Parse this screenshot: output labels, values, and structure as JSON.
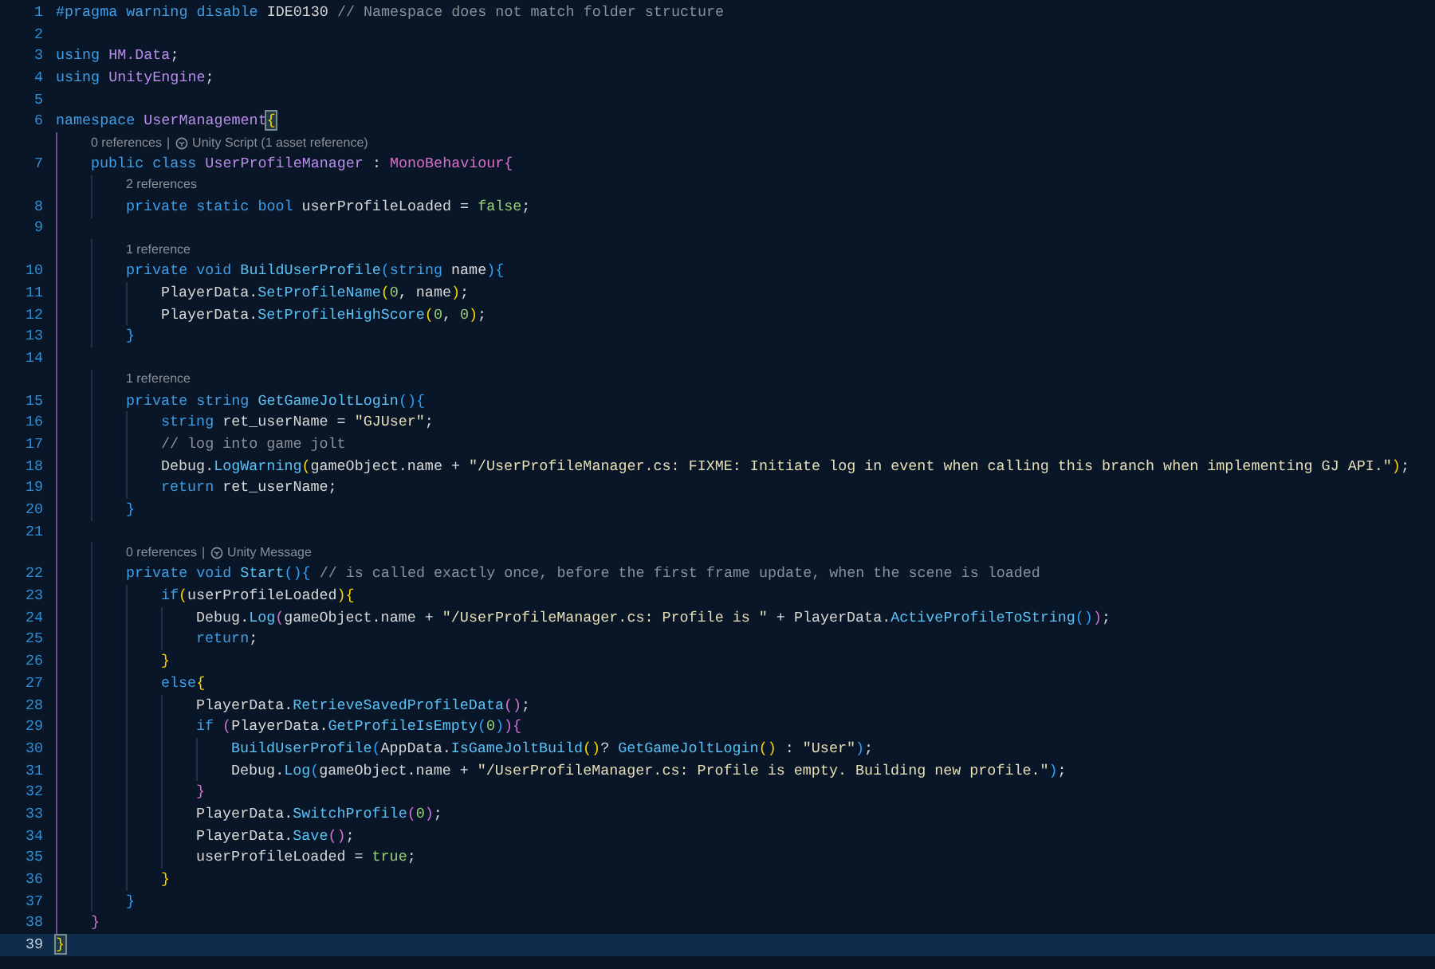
{
  "editor": {
    "lines": [
      {
        "number": "1",
        "tokens": [
          {
            "text": "#pragma warning disable",
            "kind": "k"
          },
          {
            "text": " IDE0130 ",
            "kind": "p"
          },
          {
            "text": "// Namespace does not match folder structure",
            "kind": "cm"
          }
        ]
      },
      {
        "number": "2"
      },
      {
        "number": "3",
        "tokens": [
          {
            "text": "using",
            "kind": "k"
          },
          {
            "text": " HM.Data",
            "kind": "t"
          },
          {
            "text": ";",
            "kind": "p"
          }
        ]
      },
      {
        "number": "4",
        "tokens": [
          {
            "text": "using",
            "kind": "k"
          },
          {
            "text": " UnityEngine",
            "kind": "t"
          },
          {
            "text": ";",
            "kind": "p"
          }
        ]
      },
      {
        "number": "5"
      },
      {
        "number": "6",
        "tokens": [
          {
            "text": "namespace",
            "kind": "k"
          },
          {
            "text": " UserManagement",
            "kind": "t"
          },
          {
            "text": "{",
            "kind": "b1m"
          }
        ]
      },
      {
        "number": "7",
        "lens": {
          "separator": "|",
          "items": [
            {
              "text": "0 references"
            },
            {
              "text": "Unity Script (1 asset reference)",
              "kind": "unity"
            }
          ]
        },
        "tokens": [
          {
            "text": "    public class",
            "kind": "k"
          },
          {
            "text": " UserProfileManager",
            "kind": "t"
          },
          {
            "text": " : ",
            "kind": "p"
          },
          {
            "text": "MonoBehaviour",
            "kind": "tc"
          },
          {
            "text": "{",
            "kind": "b2"
          }
        ]
      },
      {
        "number": "8",
        "lens": {
          "items": [
            {
              "text": "2 references"
            }
          ]
        },
        "tokens": [
          {
            "text": "        private static bool",
            "kind": "k"
          },
          {
            "text": " userProfileLoaded = ",
            "kind": "v"
          },
          {
            "text": "false",
            "kind": "n"
          },
          {
            "text": ";",
            "kind": "p"
          }
        ]
      },
      {
        "number": "9"
      },
      {
        "number": "10",
        "lens": {
          "items": [
            {
              "text": "1 reference"
            }
          ]
        },
        "tokens": [
          {
            "text": "        private void",
            "kind": "k"
          },
          {
            "text": " BuildUserProfile",
            "kind": "m"
          },
          {
            "text": "(",
            "kind": "b3"
          },
          {
            "text": "string",
            "kind": "k"
          },
          {
            "text": " name",
            "kind": "v"
          },
          {
            "text": "){",
            "kind": "b3"
          }
        ]
      },
      {
        "number": "11",
        "tokens": [
          {
            "text": "            PlayerData.",
            "kind": "v"
          },
          {
            "text": "SetProfileName",
            "kind": "m"
          },
          {
            "text": "(",
            "kind": "b1"
          },
          {
            "text": "0",
            "kind": "n"
          },
          {
            "text": ", name",
            "kind": "v"
          },
          {
            "text": ")",
            "kind": "b1"
          },
          {
            "text": ";",
            "kind": "p"
          }
        ]
      },
      {
        "number": "12",
        "tokens": [
          {
            "text": "            PlayerData.",
            "kind": "v"
          },
          {
            "text": "SetProfileHighScore",
            "kind": "m"
          },
          {
            "text": "(",
            "kind": "b1"
          },
          {
            "text": "0",
            "kind": "n"
          },
          {
            "text": ", ",
            "kind": "v"
          },
          {
            "text": "0",
            "kind": "n"
          },
          {
            "text": ")",
            "kind": "b1"
          },
          {
            "text": ";",
            "kind": "p"
          }
        ]
      },
      {
        "number": "13",
        "tokens": [
          {
            "text": "        }",
            "kind": "b3"
          }
        ]
      },
      {
        "number": "14"
      },
      {
        "number": "15",
        "lens": {
          "items": [
            {
              "text": "1 reference"
            }
          ]
        },
        "tokens": [
          {
            "text": "        private string",
            "kind": "k"
          },
          {
            "text": " GetGameJoltLogin",
            "kind": "m"
          },
          {
            "text": "(){",
            "kind": "b3"
          }
        ]
      },
      {
        "number": "16",
        "tokens": [
          {
            "text": "            string",
            "kind": "k"
          },
          {
            "text": " ret_userName = ",
            "kind": "v"
          },
          {
            "text": "\"GJUser\"",
            "kind": "s"
          },
          {
            "text": ";",
            "kind": "p"
          }
        ]
      },
      {
        "number": "17",
        "tokens": [
          {
            "text": "            // log into game jolt",
            "kind": "cm"
          }
        ]
      },
      {
        "number": "18",
        "tokens": [
          {
            "text": "            Debug.",
            "kind": "v"
          },
          {
            "text": "LogWarning",
            "kind": "m"
          },
          {
            "text": "(",
            "kind": "b1"
          },
          {
            "text": "gameObject.name + ",
            "kind": "v"
          },
          {
            "text": "\"/UserProfileManager.cs: FIXME: Initiate log in event when calling this branch when implementing GJ API.\"",
            "kind": "s"
          },
          {
            "text": ")",
            "kind": "b1"
          },
          {
            "text": ";",
            "kind": "p"
          }
        ]
      },
      {
        "number": "19",
        "tokens": [
          {
            "text": "            return",
            "kind": "k"
          },
          {
            "text": " ret_userName;",
            "kind": "v"
          }
        ]
      },
      {
        "number": "20",
        "tokens": [
          {
            "text": "        }",
            "kind": "b3"
          }
        ]
      },
      {
        "number": "21"
      },
      {
        "number": "22",
        "lens": {
          "separator": "|",
          "items": [
            {
              "text": "0 references"
            },
            {
              "text": "Unity Message",
              "kind": "unity"
            }
          ]
        },
        "tokens": [
          {
            "text": "        private void",
            "kind": "k"
          },
          {
            "text": " Start",
            "kind": "m"
          },
          {
            "text": "(){",
            "kind": "b3"
          },
          {
            "text": " // is called exactly once, before the first frame update, when the scene is loaded",
            "kind": "cm"
          }
        ]
      },
      {
        "number": "23",
        "tokens": [
          {
            "text": "            if",
            "kind": "k"
          },
          {
            "text": "(",
            "kind": "b1"
          },
          {
            "text": "userProfileLoaded",
            "kind": "v"
          },
          {
            "text": "){",
            "kind": "b1"
          }
        ]
      },
      {
        "number": "24",
        "tokens": [
          {
            "text": "                Debug.",
            "kind": "v"
          },
          {
            "text": "Log",
            "kind": "m"
          },
          {
            "text": "(",
            "kind": "b2"
          },
          {
            "text": "gameObject.name + ",
            "kind": "v"
          },
          {
            "text": "\"/UserProfileManager.cs: Profile is \"",
            "kind": "s"
          },
          {
            "text": " + PlayerData.",
            "kind": "v"
          },
          {
            "text": "ActiveProfileToString",
            "kind": "m"
          },
          {
            "text": "()",
            "kind": "b3"
          },
          {
            "text": ")",
            "kind": "b2"
          },
          {
            "text": ";",
            "kind": "p"
          }
        ]
      },
      {
        "number": "25",
        "tokens": [
          {
            "text": "                return",
            "kind": "k"
          },
          {
            "text": ";",
            "kind": "p"
          }
        ]
      },
      {
        "number": "26",
        "tokens": [
          {
            "text": "            }",
            "kind": "b1"
          }
        ]
      },
      {
        "number": "27",
        "tokens": [
          {
            "text": "            else",
            "kind": "k"
          },
          {
            "text": "{",
            "kind": "b1"
          }
        ]
      },
      {
        "number": "28",
        "tokens": [
          {
            "text": "                PlayerData.",
            "kind": "v"
          },
          {
            "text": "RetrieveSavedProfileData",
            "kind": "m"
          },
          {
            "text": "()",
            "kind": "b2"
          },
          {
            "text": ";",
            "kind": "p"
          }
        ]
      },
      {
        "number": "29",
        "tokens": [
          {
            "text": "                if",
            "kind": "k"
          },
          {
            "text": " (",
            "kind": "b2"
          },
          {
            "text": "PlayerData.",
            "kind": "v"
          },
          {
            "text": "GetProfileIsEmpty",
            "kind": "m"
          },
          {
            "text": "(",
            "kind": "b3"
          },
          {
            "text": "0",
            "kind": "n"
          },
          {
            "text": ")",
            "kind": "b3"
          },
          {
            "text": "){",
            "kind": "b2"
          }
        ]
      },
      {
        "number": "30",
        "tokens": [
          {
            "text": "                    BuildUserProfile",
            "kind": "m"
          },
          {
            "text": "(",
            "kind": "b3"
          },
          {
            "text": "AppData.",
            "kind": "v"
          },
          {
            "text": "IsGameJoltBuild",
            "kind": "m"
          },
          {
            "text": "()",
            "kind": "b1"
          },
          {
            "text": "? ",
            "kind": "v"
          },
          {
            "text": "GetGameJoltLogin",
            "kind": "m"
          },
          {
            "text": "()",
            "kind": "b1"
          },
          {
            "text": " : ",
            "kind": "v"
          },
          {
            "text": "\"User\"",
            "kind": "s"
          },
          {
            "text": ")",
            "kind": "b3"
          },
          {
            "text": ";",
            "kind": "p"
          }
        ]
      },
      {
        "number": "31",
        "tokens": [
          {
            "text": "                    Debug.",
            "kind": "v"
          },
          {
            "text": "Log",
            "kind": "m"
          },
          {
            "text": "(",
            "kind": "b3"
          },
          {
            "text": "gameObject.name + ",
            "kind": "v"
          },
          {
            "text": "\"/UserProfileManager.cs: Profile is empty. Building new profile.\"",
            "kind": "s"
          },
          {
            "text": ")",
            "kind": "b3"
          },
          {
            "text": ";",
            "kind": "p"
          }
        ]
      },
      {
        "number": "32",
        "tokens": [
          {
            "text": "                }",
            "kind": "b2"
          }
        ]
      },
      {
        "number": "33",
        "tokens": [
          {
            "text": "                PlayerData.",
            "kind": "v"
          },
          {
            "text": "SwitchProfile",
            "kind": "m"
          },
          {
            "text": "(",
            "kind": "b2"
          },
          {
            "text": "0",
            "kind": "n"
          },
          {
            "text": ")",
            "kind": "b2"
          },
          {
            "text": ";",
            "kind": "p"
          }
        ]
      },
      {
        "number": "34",
        "tokens": [
          {
            "text": "                PlayerData.",
            "kind": "v"
          },
          {
            "text": "Save",
            "kind": "m"
          },
          {
            "text": "()",
            "kind": "b2"
          },
          {
            "text": ";",
            "kind": "p"
          }
        ]
      },
      {
        "number": "35",
        "tokens": [
          {
            "text": "                userProfileLoaded = ",
            "kind": "v"
          },
          {
            "text": "true",
            "kind": "n"
          },
          {
            "text": ";",
            "kind": "p"
          }
        ]
      },
      {
        "number": "36",
        "tokens": [
          {
            "text": "            }",
            "kind": "b1"
          }
        ]
      },
      {
        "number": "37",
        "tokens": [
          {
            "text": "        }",
            "kind": "b3"
          }
        ]
      },
      {
        "number": "38",
        "tokens": [
          {
            "text": "    }",
            "kind": "b2"
          }
        ]
      },
      {
        "number": "39",
        "current": true,
        "tokens": [
          {
            "text": "}",
            "kind": "b1m"
          }
        ]
      }
    ]
  }
}
